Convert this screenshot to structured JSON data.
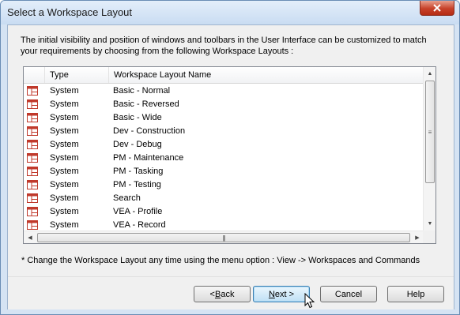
{
  "window": {
    "title": "Select a Workspace Layout"
  },
  "intro_text": "The initial visibility and position of windows and toolbars in the User Interface can be customized to match your requirements by choosing from the following Workspace Layouts :",
  "table": {
    "columns": [
      "",
      "Type",
      "Workspace Layout Name"
    ],
    "rows": [
      {
        "type": "System",
        "name": "Basic - Normal"
      },
      {
        "type": "System",
        "name": "Basic - Reversed"
      },
      {
        "type": "System",
        "name": "Basic - Wide"
      },
      {
        "type": "System",
        "name": "Dev - Construction"
      },
      {
        "type": "System",
        "name": "Dev - Debug"
      },
      {
        "type": "System",
        "name": "PM - Maintenance"
      },
      {
        "type": "System",
        "name": "PM - Tasking"
      },
      {
        "type": "System",
        "name": "PM - Testing"
      },
      {
        "type": "System",
        "name": "Search"
      },
      {
        "type": "System",
        "name": "VEA - Profile"
      },
      {
        "type": "System",
        "name": "VEA - Record"
      }
    ],
    "row_icon": "layout-icon"
  },
  "footnote": "* Change the Workspace Layout any time using the menu option : View -> Workspaces and Commands",
  "buttons": {
    "back": {
      "mnemonic": "B",
      "rest": "ack",
      "prefix": "< "
    },
    "next": {
      "mnemonic": "N",
      "rest": "ext >"
    },
    "cancel": "Cancel",
    "help": "Help"
  },
  "colors": {
    "accent": "#3c7fb1",
    "close_button": "#c7412a",
    "icon_red": "#c0392b"
  }
}
